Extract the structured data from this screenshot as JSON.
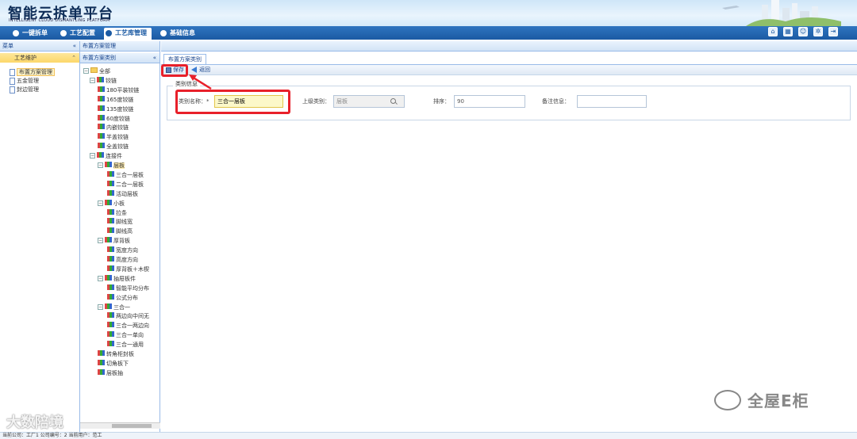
{
  "header": {
    "title": "智能云拆单平台",
    "subtitle": "INTELLIGENT CLOUD DISMANTLING PLATFORM"
  },
  "nav": {
    "items": [
      {
        "label": "一键拆单"
      },
      {
        "label": "工艺配置"
      },
      {
        "label": "工艺库管理"
      },
      {
        "label": "基础信息"
      }
    ],
    "active": "工艺库管理"
  },
  "left_panel": {
    "title": "菜单",
    "section": "工艺维护",
    "items": [
      {
        "label": "布置方案管理"
      },
      {
        "label": "五金管理"
      },
      {
        "label": "封边管理"
      }
    ]
  },
  "tree_panel": {
    "breadcrumb": "布置方案管理",
    "title": "布置方案类别",
    "nodes": [
      {
        "label": "全部",
        "level": 0
      },
      {
        "label": "铰链",
        "level": 1
      },
      {
        "label": "180平装铰链",
        "level": 2
      },
      {
        "label": "165度铰链",
        "level": 2
      },
      {
        "label": "135度铰链",
        "level": 2
      },
      {
        "label": "60度铰链",
        "level": 2
      },
      {
        "label": "内嵌铰链",
        "level": 2
      },
      {
        "label": "半盖铰链",
        "level": 2
      },
      {
        "label": "全盖铰链",
        "level": 2
      },
      {
        "label": "连接件",
        "level": 1
      },
      {
        "label": "层板",
        "level": 2
      },
      {
        "label": "三合一层板",
        "level": 3
      },
      {
        "label": "二合一层板",
        "level": 3
      },
      {
        "label": "活动层板",
        "level": 3
      },
      {
        "label": "小板",
        "level": 2
      },
      {
        "label": "拉条",
        "level": 3
      },
      {
        "label": "脚线宽",
        "level": 3
      },
      {
        "label": "脚线高",
        "level": 3
      },
      {
        "label": "厚背板",
        "level": 2
      },
      {
        "label": "宽度方向",
        "level": 3
      },
      {
        "label": "高度方向",
        "level": 3
      },
      {
        "label": "厚背板＋木楔",
        "level": 3
      },
      {
        "label": "抽屉板件",
        "level": 2
      },
      {
        "label": "智能平均分布",
        "level": 3
      },
      {
        "label": "公式分布",
        "level": 3
      },
      {
        "label": "三合一",
        "level": 2
      },
      {
        "label": "两边向中间无",
        "level": 3
      },
      {
        "label": "三合一两边向",
        "level": 3
      },
      {
        "label": "三合一单向",
        "level": 3
      },
      {
        "label": "三合一通用",
        "level": 3
      },
      {
        "label": "转角柜封板",
        "level": 2
      },
      {
        "label": "切角板下",
        "level": 2
      },
      {
        "label": "层板抽",
        "level": 2
      }
    ]
  },
  "main": {
    "tab": "布置方案类别",
    "toolbar": {
      "save": "保存",
      "back": "返回"
    },
    "form": {
      "legend": "类别信息",
      "name_label": "类别名称：*",
      "name_value": "三合一层板",
      "parent_label": "上级类别：",
      "parent_value": "层板",
      "order_label": "排序：",
      "order_value": "90",
      "remark_label": "备注信息：",
      "remark_value": ""
    }
  },
  "status": "当前公司：工厂1   公司编号：2   当前用户：范工",
  "watermarks": {
    "left": "大数陪境",
    "right": "全屋E柜"
  },
  "colors": {
    "nav": "#1b5aa3",
    "highlight": "#e8202a",
    "section": "#fcd76a"
  }
}
